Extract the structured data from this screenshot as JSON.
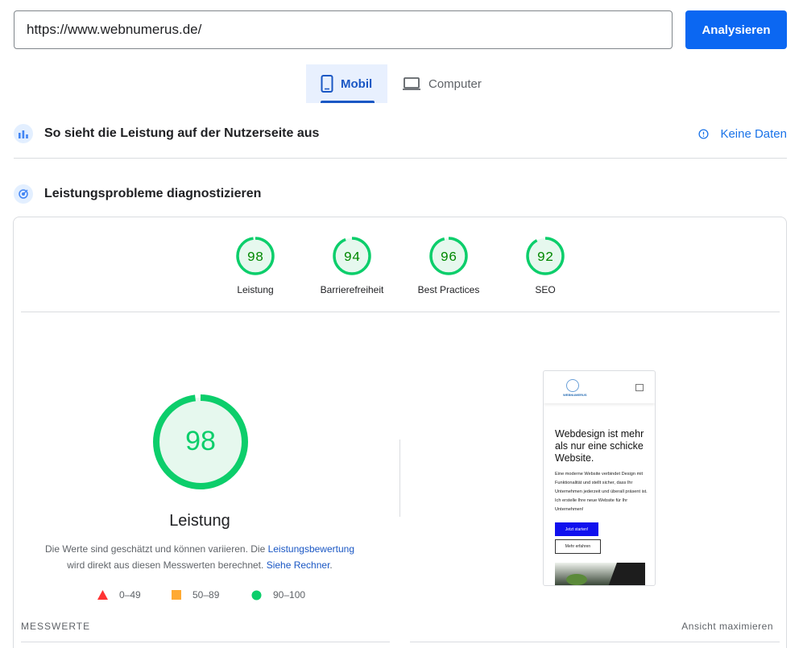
{
  "search": {
    "url_value": "https://www.webnumerus.de/",
    "analyze_label": "Analysieren"
  },
  "device_tabs": [
    {
      "label": "Mobil",
      "selected": true,
      "icon": "smartphone-icon"
    },
    {
      "label": "Computer",
      "selected": false,
      "icon": "laptop-icon"
    }
  ],
  "field_data": {
    "title": "So sieht die Leistung auf der Nutzerseite aus",
    "status_label": "Keine Daten",
    "icon": "field-data-icon"
  },
  "lab_data": {
    "title": "Leistungsprobleme diagnostizieren",
    "icon": "lab-data-icon"
  },
  "scores": [
    {
      "label": "Leistung",
      "value": 98
    },
    {
      "label": "Barrierefreiheit",
      "value": 94
    },
    {
      "label": "Best Practices",
      "value": 96
    },
    {
      "label": "SEO",
      "value": 92
    }
  ],
  "performance": {
    "score": "98",
    "score_value": 98,
    "title": "Leistung",
    "desc_part1": "Die Werte sind geschätzt und können variieren. Die ",
    "desc_link1": "Leistungsbewertung",
    "desc_part2": " wird direkt aus diesen Messwerten berechnet. ",
    "desc_link2": "Siehe Rechner",
    "desc_part3": "."
  },
  "legend": [
    {
      "range": "0–49",
      "color": "#ff3333",
      "shape": "triangle"
    },
    {
      "range": "50–89",
      "color": "#ffaa33",
      "shape": "square"
    },
    {
      "range": "90–100",
      "color": "#0cce6b",
      "shape": "circle"
    }
  ],
  "colors": {
    "pass": "#0cce6b",
    "pass_text": "#008800",
    "pass_fill": "#e6f8ee",
    "accent": "#1a73e8"
  },
  "screenshot_preview": {
    "logo_text": "WEBNUMERUS",
    "heading": "Webdesign ist mehr als nur eine schicke Website.",
    "paragraph": "Eine moderne Website verbindet Design mit Funktionalität und stellt sicher, dass Ihr Unternehmen jederzeit und überall präsent ist. Ich erstelle Ihre neue Website für Ihr Unternehmen!",
    "primary_button": "Jetzt starten!",
    "secondary_button": "Mehr erfahren"
  },
  "footer": {
    "metrics_label": "MESSWERTE",
    "expand_label": "Ansicht maximieren"
  }
}
